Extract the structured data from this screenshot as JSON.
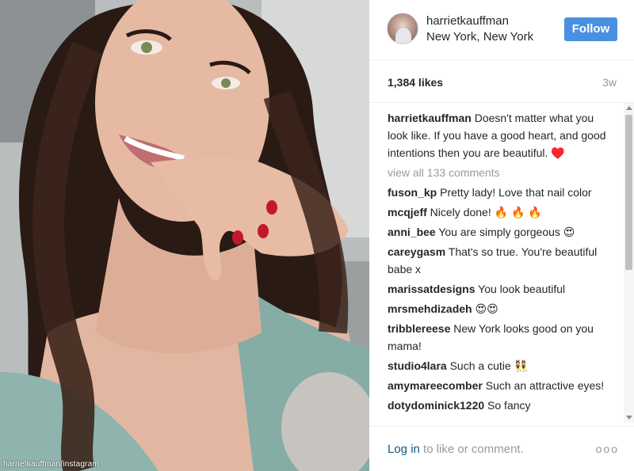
{
  "photo": {
    "credit": "harrietkauffman/instagram"
  },
  "header": {
    "username": "harrietkauffman",
    "location": "New York, New York",
    "follow_label": "Follow"
  },
  "stats": {
    "likes": "1,384 likes",
    "time_ago": "3w"
  },
  "caption": {
    "user": "harrietkauffman",
    "text": " Doesn't matter what you look like. If you have a good heart, and good intentions then you are beautiful. ♥️"
  },
  "view_all": "view all 133 comments",
  "comments": [
    {
      "user": "fuson_kp",
      "text": " Pretty lady! Love that nail color"
    },
    {
      "user": "mcqjeff",
      "text": " Nicely done! 🔥 🔥 🔥"
    },
    {
      "user": "anni_bee",
      "text": " You are simply gorgeous 😍"
    },
    {
      "user": "careygasm",
      "text": " That's so true. You're beautiful babe x"
    },
    {
      "user": "marissatdesigns",
      "text": " You look beautiful"
    },
    {
      "user": "mrsmehdizadeh",
      "text": " 😍😍"
    },
    {
      "user": "tribblereese",
      "text": " New York looks good on you mama!"
    },
    {
      "user": "studio4lara",
      "text": " Such a cutie 👯"
    },
    {
      "user": "amymareecomber",
      "text": " Such an attractive eyes!"
    },
    {
      "user": "dotydominick1220",
      "text": " So fancy"
    }
  ],
  "footer": {
    "login_link": "Log in",
    "login_rest": " to like or comment.",
    "more": "ooo"
  },
  "colors": {
    "follow_button": "#4a90e2",
    "link": "#125688",
    "muted": "#999999"
  }
}
